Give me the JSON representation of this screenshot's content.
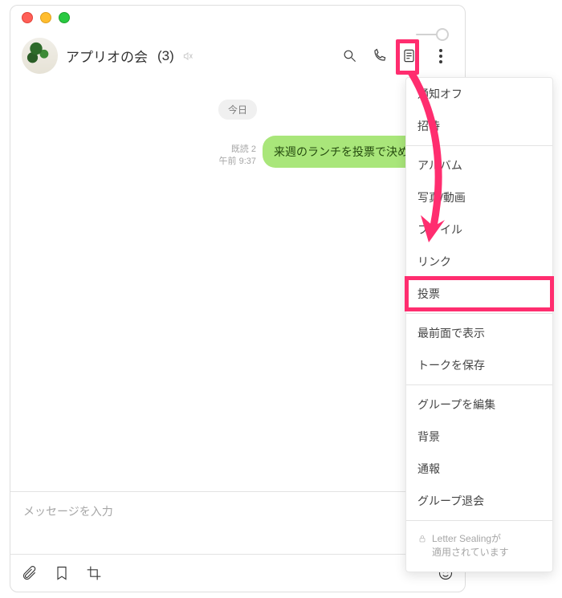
{
  "header": {
    "chat_name": "アプリオの会",
    "member_count_display": "(3)"
  },
  "chat": {
    "date_separator": "今日",
    "message": {
      "read_status": "既読 2",
      "time": "午前 9:37",
      "text": "来週のランチを投票で決めます！"
    }
  },
  "composer": {
    "placeholder": "メッセージを入力"
  },
  "menu": {
    "items": {
      "notify_off": "通知オフ",
      "invite": "招待",
      "album": "アルバム",
      "photo_video": "写真/動画",
      "file": "ファイル",
      "link": "リンク",
      "poll": "投票",
      "bring_to_front": "最前面で表示",
      "save_talk": "トークを保存",
      "edit_group": "グループを編集",
      "background": "背景",
      "report": "通報",
      "leave_group": "グループ退会"
    },
    "footer_line1": "Letter Sealingが",
    "footer_line2": "適用されています"
  }
}
